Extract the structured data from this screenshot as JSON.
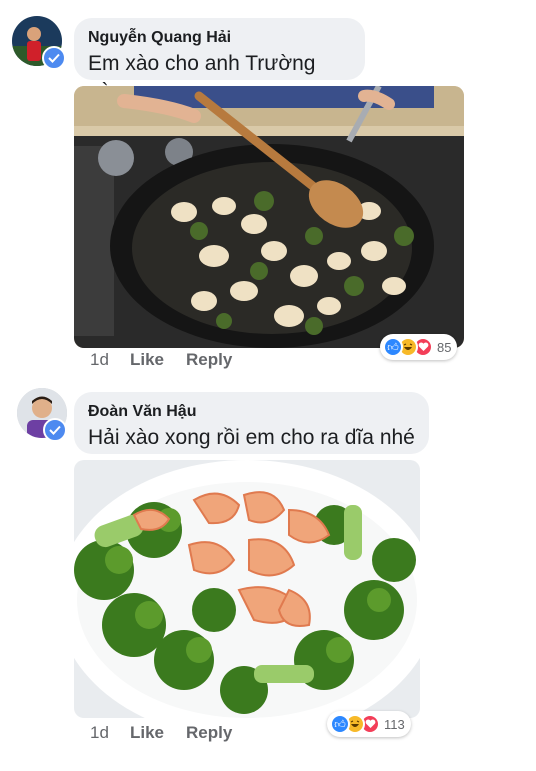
{
  "comments": [
    {
      "author": "Nguyễn Quang Hải",
      "text": "Em xào cho anh Trường này",
      "time": "1d",
      "like_label": "Like",
      "reply_label": "Reply",
      "reaction_count": "85",
      "photo_desc_icon": "frying-pan-shrimp-image"
    },
    {
      "author": "Đoàn Văn Hậu",
      "text": "Hải xào xong rồi em cho ra dĩa nhé",
      "time": "1d",
      "like_label": "Like",
      "reply_label": "Reply",
      "reaction_count": "113",
      "photo_desc_icon": "plated-shrimp-broccoli-image"
    }
  ],
  "colors": {
    "bubble": "#eef0f3",
    "meta": "#65676b",
    "like_blue": "#2d88ff",
    "haha_yellow": "#f7b928",
    "love_red": "#f33e58",
    "verified": "#4d8af0"
  }
}
